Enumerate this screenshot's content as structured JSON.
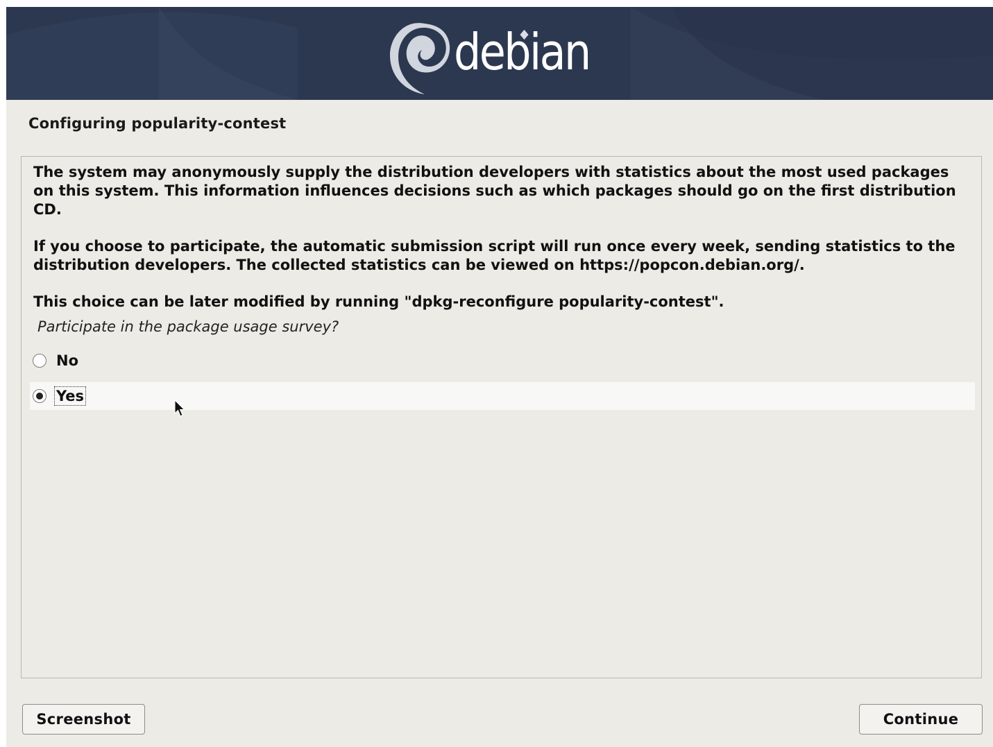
{
  "banner": {
    "logo_text": "debian"
  },
  "page": {
    "title": "Configuring popularity-contest"
  },
  "content": {
    "paragraph1": "The system may anonymously supply the distribution developers with statistics about the most used packages on this system. This information influences decisions such as which packages should go on the first distribution CD.",
    "paragraph2": "If you choose to participate, the automatic submission script will run once every week, sending statistics to the distribution developers. The collected statistics can be viewed on https://popcon.debian.org/.",
    "paragraph3": "This choice can be later modified by running \"dpkg-reconfigure popularity-contest\".",
    "question": "Participate in the package usage survey?",
    "options": [
      {
        "label": "No",
        "selected": false
      },
      {
        "label": "Yes",
        "selected": true
      }
    ]
  },
  "buttons": {
    "screenshot_label": "Screenshot",
    "continue_label": "Continue"
  },
  "colors": {
    "banner": "#2e3a52",
    "background": "#edebe6"
  }
}
